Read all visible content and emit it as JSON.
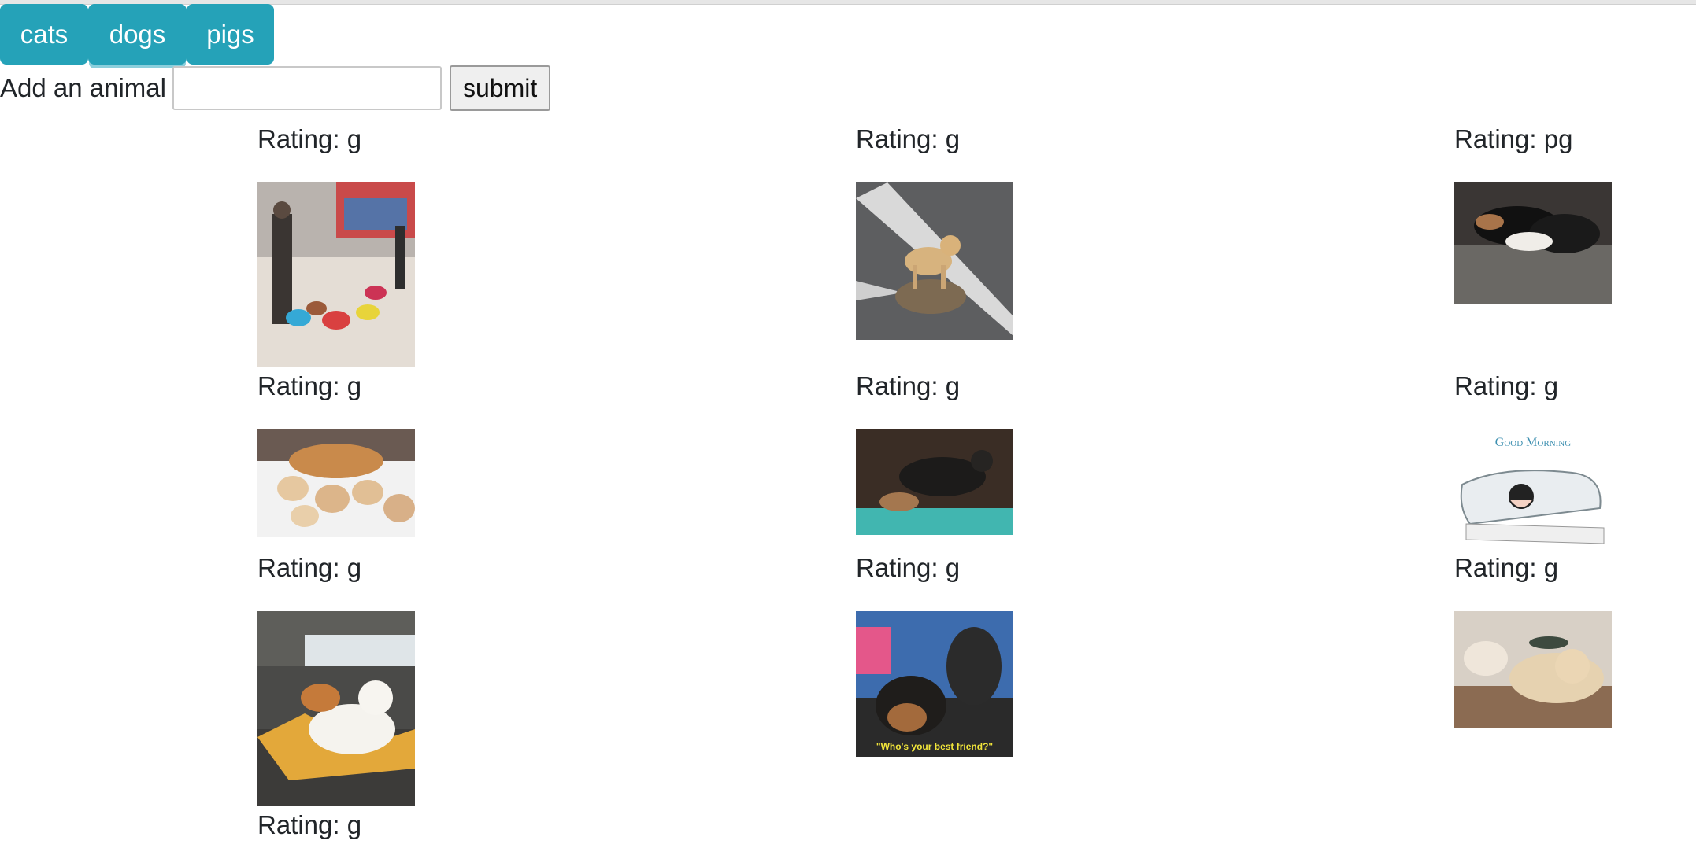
{
  "buttons": [
    {
      "label": "cats"
    },
    {
      "label": "dogs"
    },
    {
      "label": "pigs"
    }
  ],
  "add_form": {
    "label": "Add an animal",
    "input_value": "",
    "submit_label": "submit"
  },
  "gifs": [
    {
      "rating": "Rating: g",
      "image": "dogs-in-colorful-coats-walking-with-owner"
    },
    {
      "rating": "Rating: g",
      "image": "shiba-riding-tortoise-on-road"
    },
    {
      "rating": "Rating: pg",
      "image": "sleeping-dogs-on-bed"
    },
    {
      "rating": "Rating: g",
      "image": "golden-retriever-puppies-in-snow"
    },
    {
      "rating": "Rating: g",
      "image": "dog-and-small-animal-by-pool"
    },
    {
      "rating": "Rating: g",
      "image": "good-morning-cartoon"
    },
    {
      "rating": "Rating: g",
      "image": "dogs-lying-on-riverbank-rocks"
    },
    {
      "rating": "Rating: g",
      "image": "rottweiler-puppy-with-big-dog"
    },
    {
      "rating": "Rating: g",
      "image": "golden-retriever-lying-on-blanket"
    },
    {
      "rating": "Rating: g",
      "image": ""
    }
  ],
  "captions": {
    "good_morning": "Good Morning",
    "best_friend": "\"Who's your best friend?\""
  },
  "colors": {
    "button_bg": "#25a2b8",
    "button_text": "#ffffff"
  }
}
